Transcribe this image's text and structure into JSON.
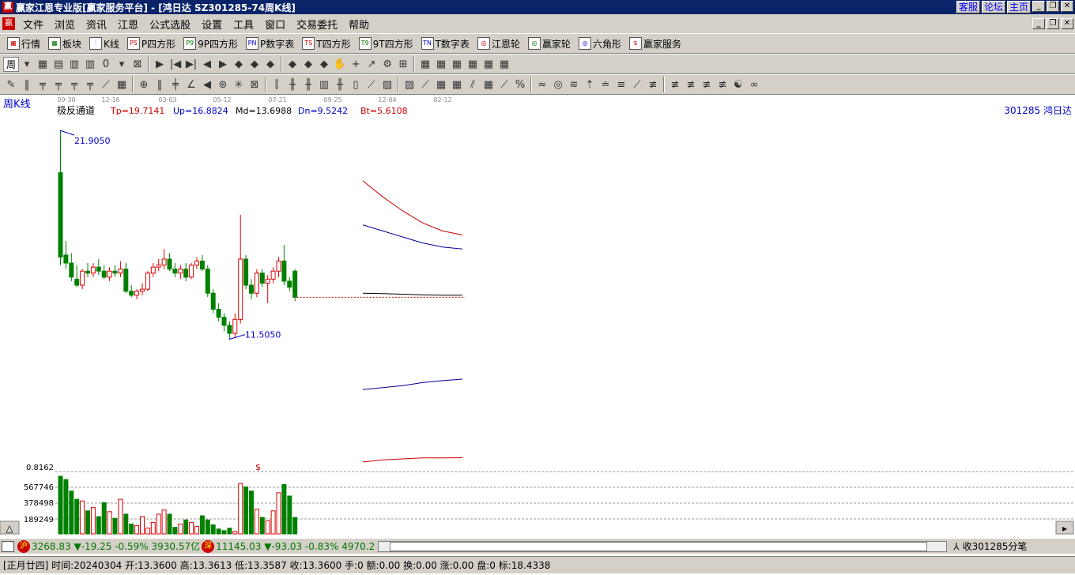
{
  "window": {
    "title": "赢家江恩专业版[赢家服务平台] - [鸿日达  SZ301285-74周K线]",
    "app_icon": "赢",
    "links": [
      "客服",
      "论坛",
      "主页"
    ],
    "buttons": [
      "_",
      "❐",
      "✕"
    ]
  },
  "menubar": {
    "icon": "赢",
    "items": [
      "文件",
      "浏览",
      "资讯",
      "江恩",
      "公式选股",
      "设置",
      "工具",
      "窗口",
      "交易委托",
      "帮助"
    ]
  },
  "toolbar1": {
    "items": [
      {
        "icon": "▦",
        "label": "行情"
      },
      {
        "icon": "▦",
        "label": "板块"
      },
      {
        "icon": "⫶",
        "label": "K线"
      },
      {
        "icon": "PS",
        "label": "P四方形"
      },
      {
        "icon": "P9",
        "label": "9P四方形"
      },
      {
        "icon": "PN",
        "label": "P数字表"
      },
      {
        "icon": "TS",
        "label": "T四方形"
      },
      {
        "icon": "T9",
        "label": "9T四方形"
      },
      {
        "icon": "TN",
        "label": "T数字表"
      },
      {
        "icon": "◎",
        "label": "江恩轮"
      },
      {
        "icon": "◎",
        "label": "赢家轮"
      },
      {
        "icon": "◎",
        "label": "六角形"
      },
      {
        "icon": "$",
        "label": "赢家服务"
      }
    ]
  },
  "toolbar2": {
    "period": "周",
    "tools": [
      "▾",
      "▦",
      "▤",
      "▥",
      "▥",
      "0",
      "▾",
      "⊠",
      "▶",
      "|◀",
      "▶|",
      "◀",
      "▶",
      "◆",
      "◆",
      "◆",
      "◆",
      "◆",
      "◆",
      "✋",
      "+",
      "↗",
      "⚙",
      "⊞",
      "▦",
      "▦",
      "▦",
      "▦",
      "▦",
      "▦"
    ]
  },
  "toolbar3": {
    "tools": [
      "✎",
      "‖",
      "╤",
      "╤",
      "╤",
      "╤",
      "⟋",
      "▦",
      "⊕",
      "‖",
      "╪",
      "∠",
      "◀",
      "⊛",
      "✳",
      "⊠",
      "⫿",
      "╫",
      "╫",
      "▥",
      "╫",
      "▯",
      "⟋",
      "▨",
      "▨",
      "⟋",
      "▦",
      "▦",
      "⫽",
      "▦",
      "⟋",
      "%",
      "≈",
      "◎",
      "≋",
      "⇡",
      "≐",
      "≡",
      "⟋",
      "≢",
      "≢",
      "≢",
      "≢",
      "≢",
      "☯",
      "∞"
    ]
  },
  "chart": {
    "period_label": "周K线",
    "date_ticks": [
      "09-30",
      "12-16",
      "03-03",
      "05-12",
      "07-21",
      "09-25",
      "12-04",
      "02-12"
    ],
    "indicator": {
      "name": "极反通道",
      "tp": "Tp=19.7141",
      "up": "Up=16.8824",
      "md": "Md=13.6988",
      "dn": "Dn=9.5242",
      "bt": "Bt=5.6108"
    },
    "stock": "301285  鸿日达",
    "high_label": "21.9050",
    "low_label": "11.5050",
    "volume_axis": [
      "0.8162",
      "567746",
      "378498",
      "189249"
    ],
    "volume_marker": "$",
    "colors": {
      "up": "#dd0000",
      "down": "#008000",
      "channel_outer": "#cc0000",
      "channel_inner": "#000099",
      "channel_mid": "#000000"
    }
  },
  "chart_data": {
    "type": "candlestick",
    "title": "",
    "bars": [
      {
        "o": 19.8,
        "h": 21.905,
        "l": 15.2,
        "c": 15.6
      },
      {
        "o": 15.7,
        "h": 16.4,
        "l": 15.0,
        "c": 15.3
      },
      {
        "o": 15.3,
        "h": 15.8,
        "l": 14.4,
        "c": 14.6
      },
      {
        "o": 14.5,
        "h": 15.2,
        "l": 14.1,
        "c": 14.2
      },
      {
        "o": 14.2,
        "h": 15.0,
        "l": 14.0,
        "c": 14.9
      },
      {
        "o": 14.9,
        "h": 15.3,
        "l": 14.6,
        "c": 14.8
      },
      {
        "o": 14.8,
        "h": 15.3,
        "l": 14.6,
        "c": 15.1
      },
      {
        "o": 15.1,
        "h": 15.5,
        "l": 14.7,
        "c": 14.9
      },
      {
        "o": 14.9,
        "h": 15.2,
        "l": 14.5,
        "c": 14.6
      },
      {
        "o": 14.6,
        "h": 15.1,
        "l": 14.4,
        "c": 14.9
      },
      {
        "o": 14.9,
        "h": 15.2,
        "l": 14.6,
        "c": 14.8
      },
      {
        "o": 14.8,
        "h": 15.4,
        "l": 14.6,
        "c": 15.0
      },
      {
        "o": 15.0,
        "h": 15.3,
        "l": 13.8,
        "c": 13.9
      },
      {
        "o": 13.9,
        "h": 14.2,
        "l": 13.6,
        "c": 13.7
      },
      {
        "o": 13.7,
        "h": 14.0,
        "l": 13.5,
        "c": 13.9
      },
      {
        "o": 13.9,
        "h": 14.3,
        "l": 13.7,
        "c": 14.0
      },
      {
        "o": 14.0,
        "h": 14.9,
        "l": 13.9,
        "c": 14.8
      },
      {
        "o": 14.8,
        "h": 15.3,
        "l": 14.6,
        "c": 15.1
      },
      {
        "o": 15.1,
        "h": 15.5,
        "l": 14.9,
        "c": 15.2
      },
      {
        "o": 15.2,
        "h": 16.0,
        "l": 15.0,
        "c": 15.5
      },
      {
        "o": 15.5,
        "h": 15.8,
        "l": 14.9,
        "c": 15.0
      },
      {
        "o": 15.0,
        "h": 15.3,
        "l": 14.6,
        "c": 14.8
      },
      {
        "o": 14.8,
        "h": 15.2,
        "l": 14.5,
        "c": 15.0
      },
      {
        "o": 15.0,
        "h": 15.3,
        "l": 14.4,
        "c": 14.6
      },
      {
        "o": 14.6,
        "h": 15.3,
        "l": 14.5,
        "c": 15.2
      },
      {
        "o": 15.2,
        "h": 15.6,
        "l": 15.0,
        "c": 15.4
      },
      {
        "o": 15.4,
        "h": 15.7,
        "l": 14.9,
        "c": 15.0
      },
      {
        "o": 15.0,
        "h": 15.2,
        "l": 13.6,
        "c": 13.8
      },
      {
        "o": 13.8,
        "h": 14.0,
        "l": 12.8,
        "c": 13.0
      },
      {
        "o": 13.0,
        "h": 13.3,
        "l": 12.4,
        "c": 12.6
      },
      {
        "o": 12.6,
        "h": 12.8,
        "l": 11.9,
        "c": 12.2
      },
      {
        "o": 12.2,
        "h": 12.4,
        "l": 11.505,
        "c": 11.8
      },
      {
        "o": 11.8,
        "h": 12.8,
        "l": 11.6,
        "c": 12.5
      },
      {
        "o": 12.5,
        "h": 17.7,
        "l": 12.3,
        "c": 15.5
      },
      {
        "o": 15.5,
        "h": 15.7,
        "l": 14.0,
        "c": 14.2
      },
      {
        "o": 14.2,
        "h": 14.5,
        "l": 13.5,
        "c": 13.8
      },
      {
        "o": 13.8,
        "h": 15.0,
        "l": 13.6,
        "c": 14.8
      },
      {
        "o": 14.8,
        "h": 15.0,
        "l": 14.1,
        "c": 14.3
      },
      {
        "o": 14.3,
        "h": 14.7,
        "l": 13.3,
        "c": 14.5
      },
      {
        "o": 14.5,
        "h": 15.1,
        "l": 14.3,
        "c": 14.9
      },
      {
        "o": 14.9,
        "h": 15.6,
        "l": 14.6,
        "c": 15.4
      },
      {
        "o": 15.4,
        "h": 16.2,
        "l": 14.2,
        "c": 14.4
      },
      {
        "o": 14.4,
        "h": 14.6,
        "l": 13.9,
        "c": 14.1
      },
      {
        "o": 14.9,
        "h": 15.0,
        "l": 13.4,
        "c": 13.6
      }
    ],
    "volume": [
      700000,
      660000,
      520000,
      420000,
      400000,
      280000,
      320000,
      210000,
      380000,
      270000,
      190000,
      420000,
      240000,
      120000,
      100000,
      210000,
      70000,
      140000,
      240000,
      290000,
      240000,
      80000,
      120000,
      170000,
      140000,
      90000,
      220000,
      170000,
      110000,
      60000,
      40000,
      70000,
      30000,
      610000,
      570000,
      520000,
      300000,
      200000,
      160000,
      280000,
      500000,
      600000,
      460000,
      200000
    ],
    "volume_max": 756994,
    "channel": {
      "tp": [
        19.4,
        18.6,
        17.9,
        17.3,
        16.9,
        16.7
      ],
      "up": [
        17.2,
        16.9,
        16.6,
        16.3,
        16.1,
        16.0
      ],
      "md": [
        13.8,
        13.78,
        13.75,
        13.72,
        13.7,
        13.6988
      ],
      "dn": [
        9.0,
        9.1,
        9.2,
        9.35,
        9.45,
        9.5242
      ],
      "bt": [
        5.4,
        5.5,
        5.55,
        5.6,
        5.6,
        5.6108
      ]
    },
    "ylim": [
      5.0,
      22.5
    ]
  },
  "status1": {
    "sh_badge": "沪",
    "sh": {
      "value": "3268.83",
      "arrow": "▼",
      "change": "-19.25",
      "pct": "-0.59%",
      "amount": "3930.57亿"
    },
    "sz_badge": "深",
    "sz": {
      "value": "11145.03",
      "arrow": "▼",
      "change": "-93.03",
      "pct": "-0.83%",
      "amount": "4970.2"
    },
    "ticker": "收301285分笔"
  },
  "status2": {
    "text": "[正月廿四] 时间:20240304 开:13.3600 高:13.3613 低:13.3587 收:13.3600 手:0 额:0.00 换:0.00 涨:0.00 盘:0 标:18.4338"
  }
}
